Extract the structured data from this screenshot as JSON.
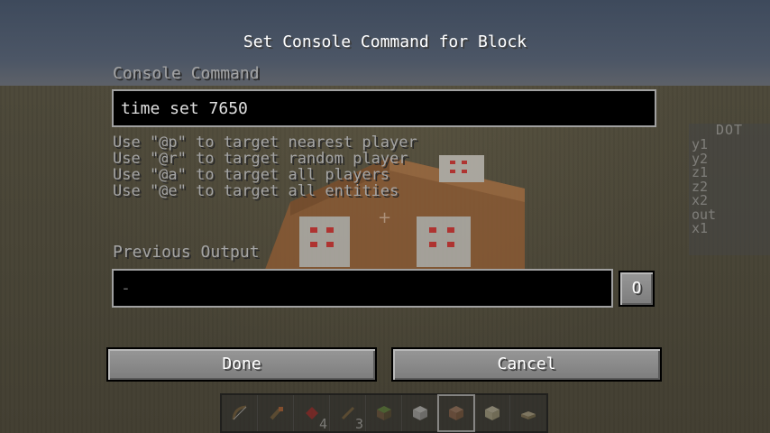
{
  "dialog": {
    "title": "Set Console Command for Block",
    "command_label": "Console Command",
    "command_value": "time set 7650",
    "hints": [
      "Use \"@p\" to target nearest player",
      "Use \"@r\" to target random player",
      "Use \"@a\" to target all players",
      "Use \"@e\" to target all entities"
    ],
    "output_label": "Previous Output",
    "output_value": "-",
    "output_toggle_label": "O",
    "done_label": "Done",
    "cancel_label": "Cancel"
  },
  "scoreboard": {
    "title": "DOT",
    "rows": [
      "y1",
      "y2",
      "z1",
      "z2",
      "x2",
      "out",
      "x1"
    ]
  },
  "hotbar": {
    "slots": [
      {
        "item": "bow-icon",
        "count": ""
      },
      {
        "item": "torch-icon",
        "count": ""
      },
      {
        "item": "redstone-icon",
        "count": "4"
      },
      {
        "item": "stick-icon",
        "count": "3"
      },
      {
        "item": "grass-block-icon",
        "count": ""
      },
      {
        "item": "quartz-block-icon",
        "count": ""
      },
      {
        "item": "command-block-icon",
        "count": "",
        "selected": true
      },
      {
        "item": "sandstone-icon",
        "count": ""
      },
      {
        "item": "daylight-sensor-icon",
        "count": ""
      }
    ]
  },
  "colors": {
    "sky": "#4c5666",
    "ground": "#4a4638",
    "field_border": "#a0a0a0",
    "label_text": "#a4a4a4",
    "button_face": "#8a8a8a"
  }
}
